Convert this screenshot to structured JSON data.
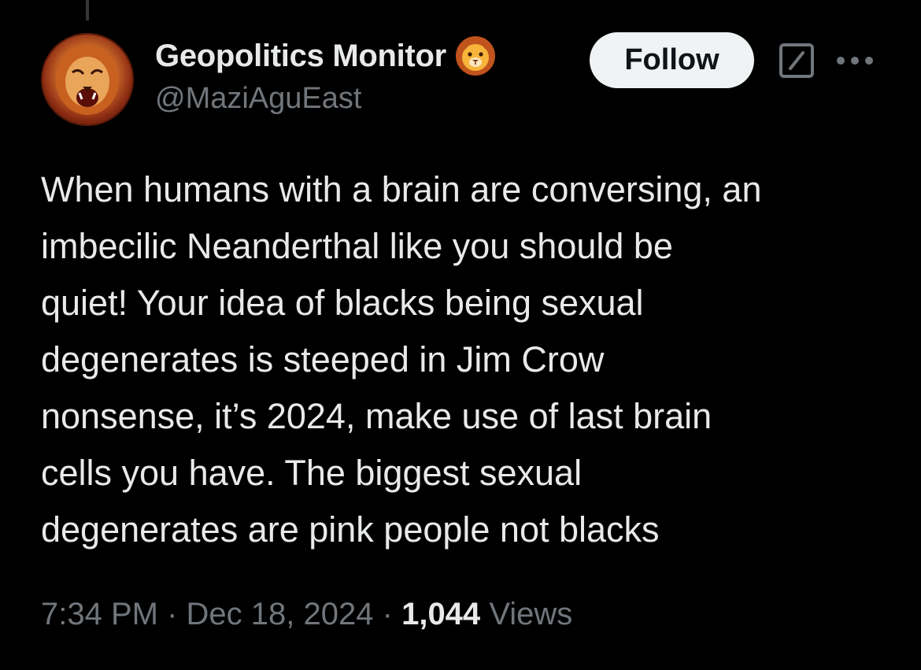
{
  "author": {
    "display_name": "Geopolitics Monitor",
    "handle": "@MaziAguEast",
    "avatar_icon": "lion-avatar",
    "badge_icon": "lion-emoji"
  },
  "actions": {
    "follow_label": "Follow",
    "grok_icon": "grok-icon",
    "more_icon": "more-options-icon"
  },
  "tweet": {
    "lines": [
      "When humans with a brain are conversing, an",
      "imbecilic Neanderthal like you should be",
      "quiet! Your idea of blacks being sexual",
      "degenerates is steeped in Jim Crow",
      "nonsense, it’s 2024, make use of last brain",
      "cells you have. The biggest sexual",
      "degenerates are pink people not blacks"
    ]
  },
  "meta": {
    "time": "7:34 PM",
    "separator": "·",
    "date": "Dec 18, 2024",
    "views_count": "1,044",
    "views_label": "Views"
  },
  "colors": {
    "background": "#000000",
    "primary_text": "#e7e9ea",
    "secondary_text": "#71767b",
    "follow_bg": "#eff3f4"
  }
}
